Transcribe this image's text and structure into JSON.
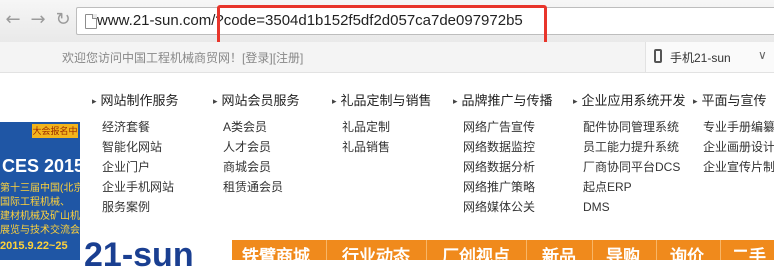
{
  "browser": {
    "url_host": "www.21-sun.com/",
    "url_query": "?code=3504d1b152f5df2d057ca7de097972b5"
  },
  "infobar": {
    "welcome": "欢迎您访问中国工程机械商贸网！",
    "login": "[登录]",
    "register": "[注册]",
    "mobile_label": "手机21-sun"
  },
  "menu": [
    {
      "title": "网站制作服务",
      "items": [
        "经济套餐",
        "智能化网站",
        "企业门户",
        "企业手机网站",
        "服务案例"
      ]
    },
    {
      "title": "网站会员服务",
      "items": [
        "A类会员",
        "人才会员",
        "商城会员",
        "租赁通会员"
      ]
    },
    {
      "title": "礼品定制与销售",
      "items": [
        "礼品定制",
        "礼品销售"
      ]
    },
    {
      "title": "品牌推广与传播",
      "items": [
        "网络广告宣传",
        "网络数据监控",
        "网络数据分析",
        "网络推广策略",
        "网络媒体公关"
      ]
    },
    {
      "title": "企业应用系统开发",
      "items": [
        "配件协同管理系统",
        "员工能力提升系统",
        "厂商协同平台DCS",
        "起点ERP",
        "DMS"
      ]
    },
    {
      "title": "平面与宣传",
      "items": [
        "专业手册编纂",
        "企业画册设计",
        "企业宣传片制作"
      ]
    }
  ],
  "ad": {
    "tag": "大会报名中",
    "title": "CES 2015",
    "lines": [
      "第十三届中国(北京)",
      "国际工程机械、",
      "建材机械及矿山机械",
      "展览与技术交流会"
    ],
    "date": "2015.9.22~25"
  },
  "logo": "21-sun",
  "mainnav": [
    "铁臂商城",
    "行业动态",
    "厂创视点",
    "新品",
    "导购",
    "询价",
    "二手"
  ],
  "colors": {
    "highlight": "#e8352b",
    "nav_orange": "#f08a1c",
    "logo_blue": "#1a3f91"
  }
}
